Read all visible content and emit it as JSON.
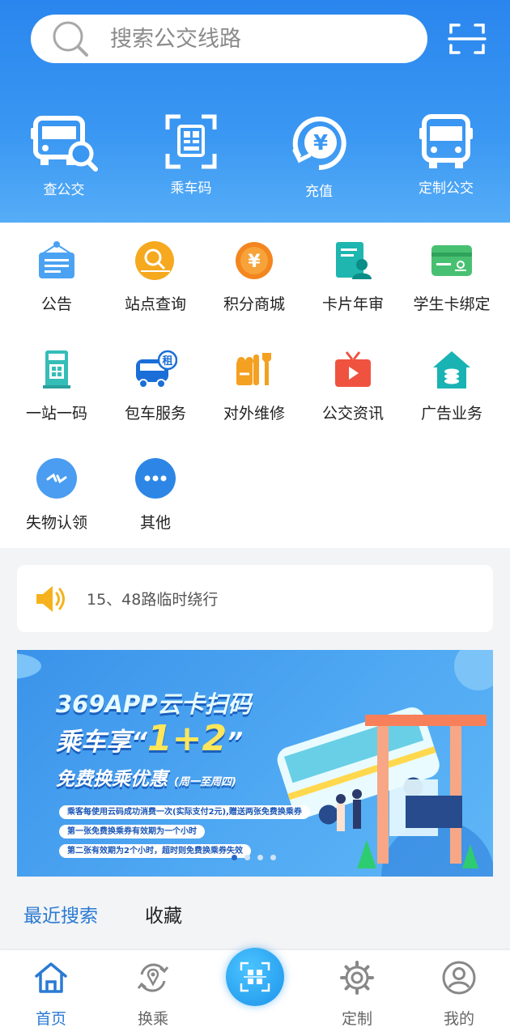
{
  "search": {
    "placeholder": "搜索公交线路"
  },
  "quick_actions": [
    {
      "label": "查公交",
      "icon": "bus-search-icon"
    },
    {
      "label": "乘车码",
      "icon": "qr-ride-code-icon"
    },
    {
      "label": "充值",
      "icon": "yuan-recharge-icon"
    },
    {
      "label": "定制公交",
      "icon": "custom-bus-icon"
    }
  ],
  "services": [
    {
      "label": "公告",
      "icon": "announcement-icon"
    },
    {
      "label": "站点查询",
      "icon": "station-query-icon"
    },
    {
      "label": "积分商城",
      "icon": "points-mall-icon"
    },
    {
      "label": "卡片年审",
      "icon": "card-review-icon"
    },
    {
      "label": "学生卡绑定",
      "icon": "student-card-icon"
    },
    {
      "label": "一站一码",
      "icon": "station-code-icon"
    },
    {
      "label": "包车服务",
      "icon": "charter-bus-icon"
    },
    {
      "label": "对外维修",
      "icon": "repair-icon"
    },
    {
      "label": "公交资讯",
      "icon": "bus-news-icon"
    },
    {
      "label": "广告业务",
      "icon": "ad-business-icon"
    },
    {
      "label": "失物认领",
      "icon": "lost-found-icon"
    },
    {
      "label": "其他",
      "icon": "more-icon"
    }
  ],
  "notice": {
    "text": "15、48路临时绕行",
    "icon": "speaker-icon"
  },
  "banner": {
    "line1": "369APP云卡扫码",
    "line2a": "乘车享“",
    "line2b": "1+2",
    "line2c": "”",
    "line3": "免费换乘优惠",
    "line3_note": "(周一至周四)",
    "rules": [
      "乘客每使用云码成功消费一次(实际支付2元),赠送两张免费换乘券",
      "第一张免费换乘券有效期为一个小时",
      "第二张有效期为2个小时，超时则免费换乘券失效"
    ],
    "page_count": 4,
    "active_page": 1
  },
  "tabs": {
    "recent": "最近搜索",
    "favorites": "收藏"
  },
  "bottom_nav": [
    {
      "label": "首页",
      "icon": "home-icon"
    },
    {
      "label": "换乘",
      "icon": "transfer-icon"
    },
    {
      "label": "",
      "icon": "scan-qr-icon"
    },
    {
      "label": "定制",
      "icon": "custom-gear-icon"
    },
    {
      "label": "我的",
      "icon": "profile-icon"
    }
  ],
  "colors": {
    "primary": "#2a86ee",
    "active_tab": "#2a7ad3",
    "background": "#f3f4f6"
  }
}
